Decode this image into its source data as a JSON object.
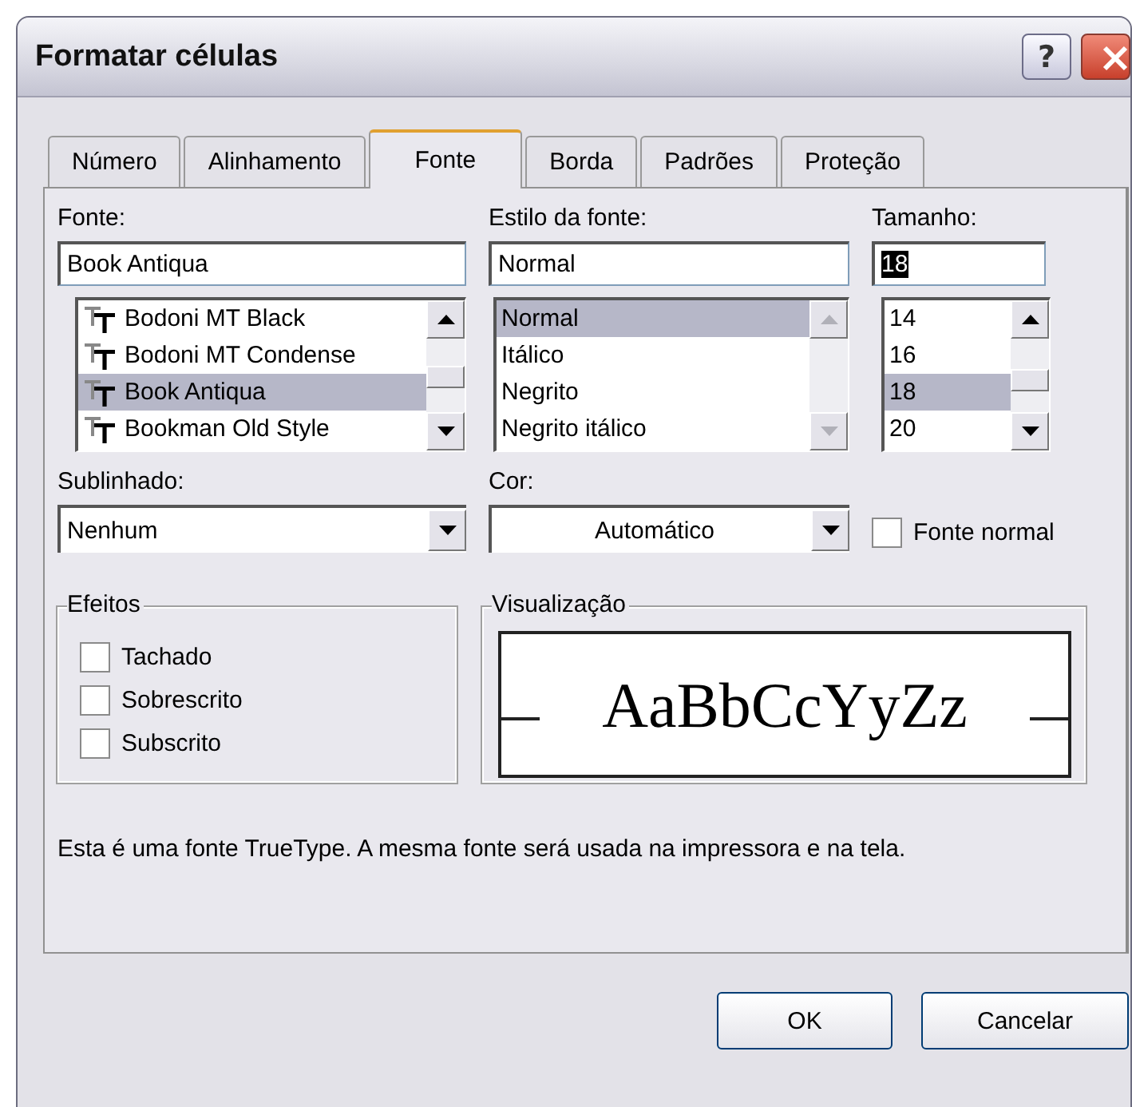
{
  "window": {
    "title": "Formatar células",
    "help": "?"
  },
  "tabs": [
    {
      "label": "Número",
      "selected": false
    },
    {
      "label": "Alinhamento",
      "selected": false
    },
    {
      "label": "Fonte",
      "selected": true
    },
    {
      "label": "Borda",
      "selected": false
    },
    {
      "label": "Padrões",
      "selected": false
    },
    {
      "label": "Proteção",
      "selected": false
    }
  ],
  "lists": [
    {
      "kind": "font",
      "label": "Fonte:",
      "value": "Book Antiqua",
      "text_selected": false,
      "scrollbar_disabled": false,
      "items": [
        {
          "label": "Bodoni MT Black",
          "selected": false
        },
        {
          "label": "Bodoni MT Condense",
          "selected": false
        },
        {
          "label": "Book Antiqua",
          "selected": true
        },
        {
          "label": "Bookman Old Style",
          "selected": false
        }
      ]
    },
    {
      "kind": "style",
      "label": "Estilo da fonte:",
      "value": "Normal",
      "text_selected": false,
      "scrollbar_disabled": true,
      "items": [
        {
          "label": "Normal",
          "selected": true
        },
        {
          "label": "Itálico",
          "selected": false
        },
        {
          "label": "Negrito",
          "selected": false
        },
        {
          "label": "Negrito itálico",
          "selected": false
        }
      ]
    },
    {
      "kind": "size",
      "label": "Tamanho:",
      "value": "18",
      "text_selected": true,
      "scrollbar_disabled": false,
      "items": [
        {
          "label": "14",
          "selected": false
        },
        {
          "label": "16",
          "selected": false
        },
        {
          "label": "18",
          "selected": true
        },
        {
          "label": "20",
          "selected": false
        }
      ]
    }
  ],
  "combos": [
    {
      "kind": "underline",
      "label": "Sublinhado:",
      "value": "Nenhum"
    },
    {
      "kind": "color",
      "label": "Cor:",
      "value": "Automático"
    }
  ],
  "normal_font": {
    "label": "Fonte normal",
    "checked": false
  },
  "effects": {
    "title": "Efeitos",
    "options": [
      {
        "label": "Tachado",
        "checked": false
      },
      {
        "label": "Sobrescrito",
        "checked": false
      },
      {
        "label": "Subscrito",
        "checked": false
      }
    ]
  },
  "preview": {
    "title": "Visualização",
    "sample": "AaBbCcYyZz"
  },
  "info": "Esta é uma fonte TrueType. A mesma fonte será usada na impressora e na tela.",
  "buttons": [
    "OK",
    "Cancelar"
  ]
}
